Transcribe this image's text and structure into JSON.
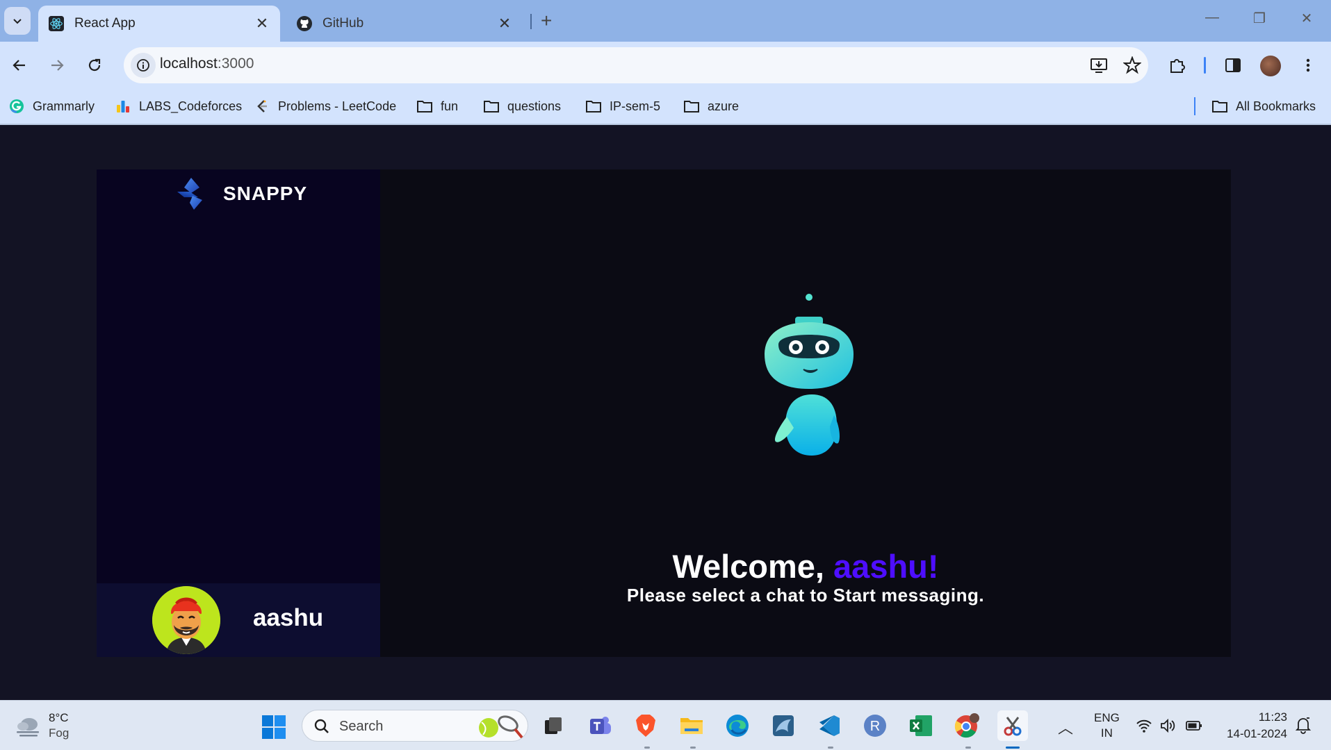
{
  "browser": {
    "tabs": [
      {
        "title": "React App",
        "active": true
      },
      {
        "title": "GitHub",
        "active": false
      }
    ],
    "address": {
      "host": "localhost",
      "port": ":3000"
    },
    "bookmarks": [
      {
        "label": "Grammarly",
        "icon": "grammarly-icon"
      },
      {
        "label": "LABS_Codeforces",
        "icon": "codeforces-icon"
      },
      {
        "label": "Problems - LeetCode",
        "icon": "leetcode-icon"
      },
      {
        "label": "fun",
        "icon": "folder-icon"
      },
      {
        "label": "questions",
        "icon": "folder-icon"
      },
      {
        "label": "IP-sem-5",
        "icon": "folder-icon"
      },
      {
        "label": "azure",
        "icon": "folder-icon"
      }
    ],
    "all_bookmarks": "All Bookmarks"
  },
  "app": {
    "brand": "SNAPPY",
    "current_user": "aashu",
    "welcome_prefix": "Welcome, ",
    "welcome_name": "aashu!",
    "subtitle": "Please select a chat to Start messaging.",
    "colors": {
      "accent": "#4e0eff",
      "contacts_bg": "#080420",
      "user_bar_bg": "#0d0d30",
      "chat_bg": "#0b0b14",
      "page_bg": "#131324"
    }
  },
  "taskbar": {
    "weather": {
      "temp": "8°C",
      "condition": "Fog"
    },
    "search_placeholder": "Search",
    "language": {
      "line1": "ENG",
      "line2": "IN"
    },
    "time": "11:23",
    "date": "14-01-2024"
  }
}
